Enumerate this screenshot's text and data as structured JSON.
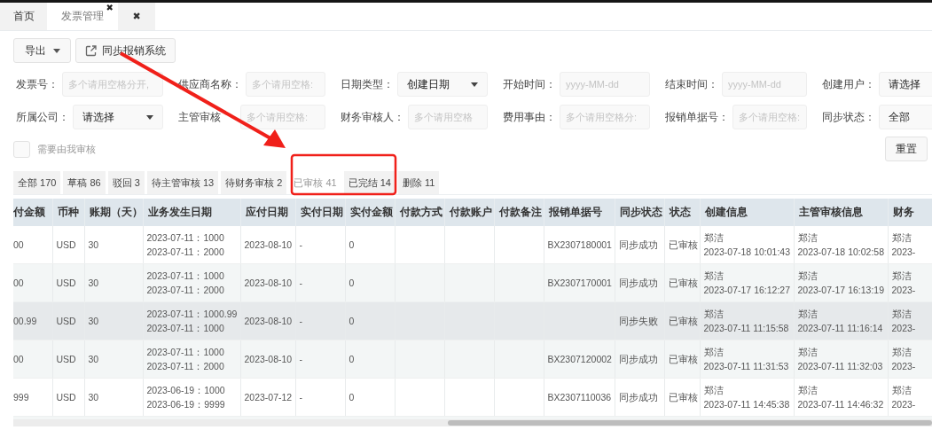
{
  "page_tabs": [
    {
      "label": "首页",
      "selected": false
    },
    {
      "label": "发票管理",
      "selected": true,
      "close_glyph": "✖"
    }
  ],
  "close_all_glyph": "✖",
  "toolbar": {
    "export_button": "导出",
    "sync_button": "同步报销系统"
  },
  "filter_rows": [
    [
      {
        "label": "发票号：",
        "kind": "text",
        "placeholder": "多个请用空格分开,"
      },
      {
        "label": "供应商名称：",
        "kind": "text",
        "placeholder": "多个请用空格:"
      },
      {
        "label": "日期类型：",
        "kind": "select",
        "value": "创建日期"
      },
      {
        "label": "开始时间：",
        "kind": "text",
        "placeholder": "yyyy-MM-dd"
      },
      {
        "label": "结束时间：",
        "kind": "text",
        "placeholder": "yyyy-MM-dd"
      },
      {
        "label": "创建用户：",
        "kind": "select",
        "value": "请选择"
      }
    ],
    [
      {
        "label": "所属公司：",
        "kind": "select",
        "value": "请选择"
      },
      {
        "label": "主管审核",
        "kind": "text",
        "placeholder": "多个请用空格:"
      },
      {
        "label": "财务审核人：",
        "kind": "text",
        "placeholder": "多个请用空格"
      },
      {
        "label": "费用事由：",
        "kind": "text",
        "placeholder": "多个请用空格分:"
      },
      {
        "label": "报销单据号：",
        "kind": "text",
        "placeholder": "多个请用空格:"
      },
      {
        "label": "同步状态：",
        "kind": "select",
        "value": "全部"
      }
    ]
  ],
  "my_review_checkbox": {
    "label": "需要由我审核",
    "checked": false
  },
  "reset_button": "重置",
  "status_tabs": [
    {
      "label": "全部 170",
      "selected": false
    },
    {
      "label": "草稿 86",
      "selected": false
    },
    {
      "label": "驳回 3",
      "selected": false
    },
    {
      "label": "待主管审核 13",
      "selected": false
    },
    {
      "label": "待财务审核 2",
      "selected": false
    },
    {
      "label": "已审核 41",
      "selected": true
    },
    {
      "label": "已完结 14",
      "selected": false
    },
    {
      "label": "删除 11",
      "selected": false
    }
  ],
  "table": {
    "columns": [
      "付金额",
      "币种",
      "账期（天）",
      "业务发生日期",
      "应付日期",
      "实付日期",
      "实付金额",
      "付款方式",
      "付款账户",
      "付款备注",
      "报销单据号",
      "同步状态",
      "状态",
      "创建信息",
      "主管审核信息",
      "财务"
    ],
    "rows": [
      {
        "highlighted": false,
        "cells": [
          "00",
          "USD",
          "30",
          [
            "2023-07-11：1000",
            "2023-07-11：2000"
          ],
          "2023-08-10",
          "-",
          "0",
          null,
          null,
          null,
          "BX2307180001",
          "同步成功",
          "已审核",
          [
            "郑洁",
            "2023-07-18 10:01:43"
          ],
          [
            "郑洁",
            "2023-07-18 10:02:58"
          ],
          [
            "郑洁",
            "2023-"
          ]
        ]
      },
      {
        "highlighted": false,
        "cells": [
          "00",
          "USD",
          "30",
          [
            "2023-07-11：1000",
            "2023-07-11：2000"
          ],
          "2023-08-10",
          "-",
          "0",
          null,
          null,
          null,
          "BX2307170001",
          "同步成功",
          "已审核",
          [
            "郑洁",
            "2023-07-17 16:12:27"
          ],
          [
            "郑洁",
            "2023-07-17 16:13:19"
          ],
          [
            "郑洁",
            "2023-"
          ]
        ]
      },
      {
        "highlighted": true,
        "cells": [
          "00.99",
          "USD",
          "30",
          [
            "2023-07-11：1000.99",
            "2023-07-11：1000"
          ],
          "2023-08-10",
          "-",
          "0",
          null,
          null,
          null,
          null,
          "同步失败",
          "已审核",
          [
            "郑洁",
            "2023-07-11 11:15:58"
          ],
          [
            "郑洁",
            "2023-07-11 11:16:14"
          ],
          [
            "郑洁",
            "2023-"
          ]
        ]
      },
      {
        "highlighted": false,
        "cells": [
          "00",
          "USD",
          "30",
          [
            "2023-07-11：1000",
            "2023-07-11：2000"
          ],
          "2023-08-10",
          "-",
          "0",
          null,
          null,
          null,
          "BX2307120002",
          "同步成功",
          "已审核",
          [
            "郑洁",
            "2023-07-11 11:31:53"
          ],
          [
            "郑洁",
            "2023-07-11 11:32:03"
          ],
          [
            "郑洁",
            "2023-"
          ]
        ]
      },
      {
        "highlighted": false,
        "cells": [
          "999",
          "USD",
          "30",
          [
            "2023-06-19：1000",
            "2023-06-19：9999"
          ],
          "2023-07-12",
          "-",
          "0",
          null,
          null,
          null,
          "BX2307110036",
          "同步成功",
          "已审核",
          [
            "郑洁",
            "2023-07-11 14:45:38"
          ],
          [
            "郑洁",
            "2023-07-11 14:46:32"
          ],
          [
            "郑洁",
            "2023-"
          ]
        ]
      }
    ]
  }
}
